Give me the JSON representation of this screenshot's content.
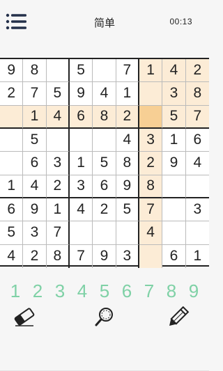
{
  "header": {
    "title": "简单",
    "timer": "00:13",
    "menu_icon": "menu-icon"
  },
  "board": {
    "rows": [
      [
        "9",
        "8",
        "",
        "5",
        "",
        "7",
        "1",
        "4",
        "2"
      ],
      [
        "2",
        "7",
        "5",
        "9",
        "4",
        "1",
        "",
        "3",
        "8"
      ],
      [
        "",
        "1",
        "4",
        "6",
        "8",
        "2",
        "",
        "5",
        "7"
      ],
      [
        "",
        "5",
        "",
        "",
        "",
        "4",
        "3",
        "1",
        "6"
      ],
      [
        "",
        "6",
        "3",
        "1",
        "5",
        "8",
        "2",
        "9",
        "4"
      ],
      [
        "1",
        "4",
        "2",
        "3",
        "6",
        "9",
        "8",
        "",
        ""
      ],
      [
        "6",
        "9",
        "1",
        "4",
        "2",
        "5",
        "7",
        "",
        "3"
      ],
      [
        "5",
        "3",
        "7",
        "",
        "",
        "",
        "4",
        "",
        ""
      ],
      [
        "4",
        "2",
        "8",
        "7",
        "9",
        "3",
        "",
        "6",
        "1"
      ]
    ],
    "selected_cell": {
      "row": 3,
      "col": 7
    },
    "highlight_color": "#fcecd6",
    "selected_color": "#f7cf94"
  },
  "numpad": {
    "keys": [
      "1",
      "2",
      "3",
      "4",
      "5",
      "6",
      "7",
      "8",
      "9"
    ],
    "color": "#7fd1a6"
  },
  "tools": {
    "eraser_icon": "eraser-icon",
    "hint_icon": "magnifier-icon",
    "pencil_icon": "pencil-icon"
  }
}
